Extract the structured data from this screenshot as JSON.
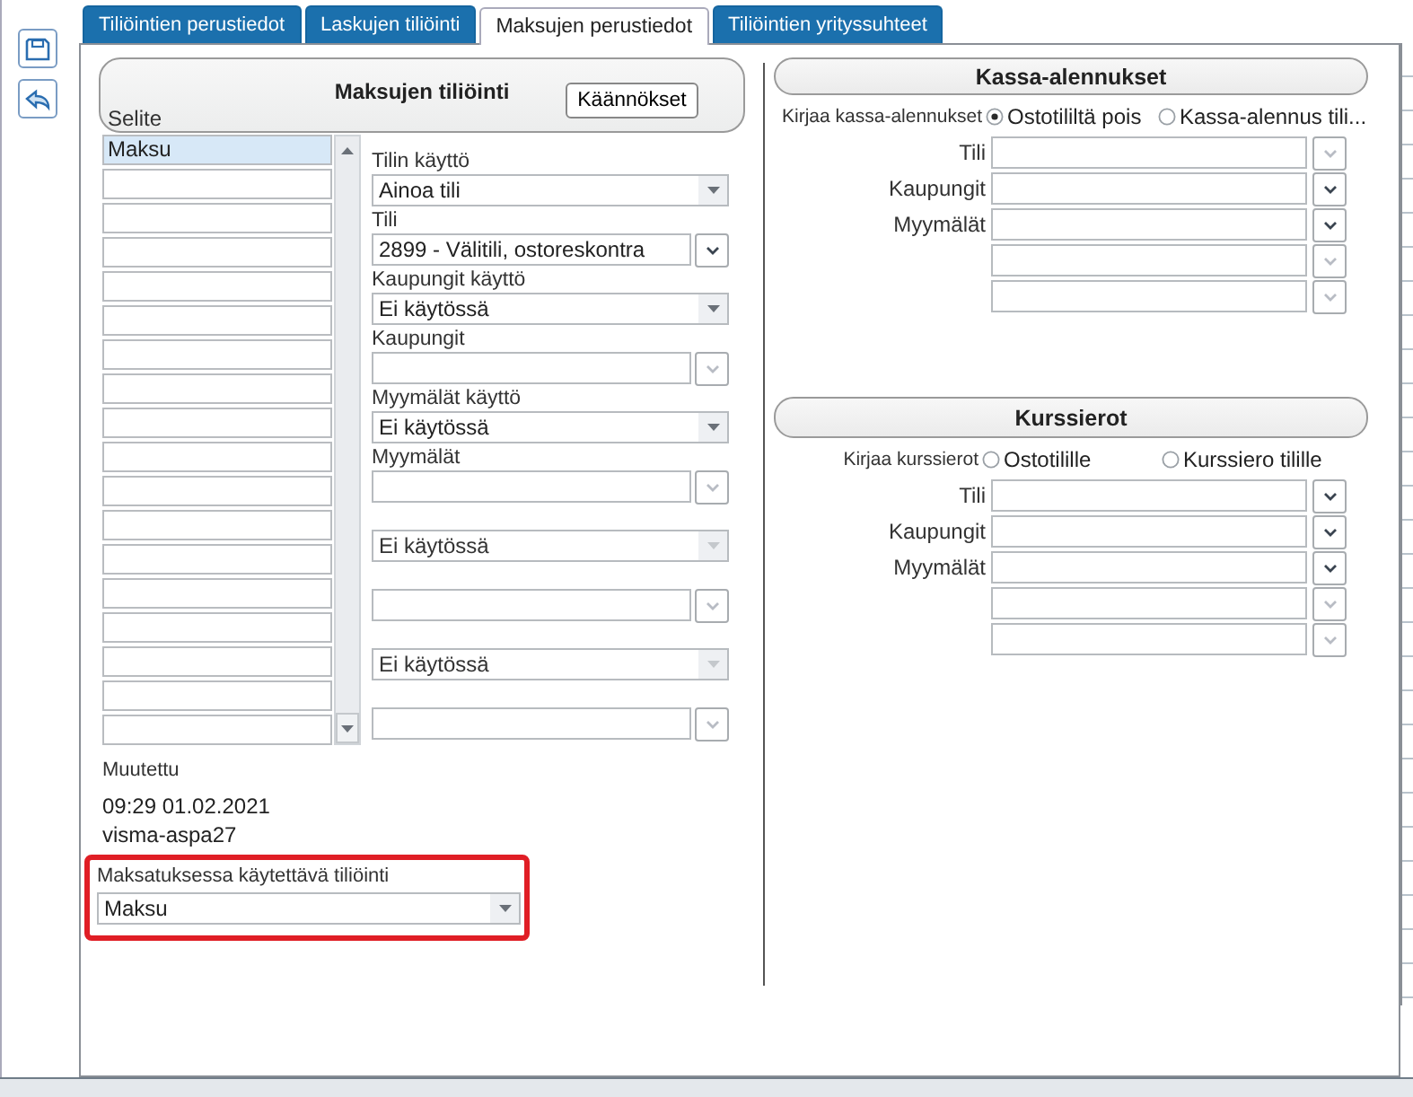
{
  "toolbar": [
    {
      "kind": "save"
    },
    {
      "kind": "undo"
    }
  ],
  "tabs": [
    {
      "label": "Tiliöintien perustiedot",
      "selected": false
    },
    {
      "label": "Laskujen tiliöinti",
      "selected": false
    },
    {
      "label": "Maksujen perustiedot",
      "selected": true
    },
    {
      "label": "Tiliöintien yrityssuhteet",
      "selected": false
    }
  ],
  "payment_posting": {
    "title": "Maksujen tiliöinti",
    "translations_button": "Käännökset",
    "description_label": "Selite",
    "descriptions": [
      {
        "value": "Maksu",
        "selected": true
      },
      {
        "selected": false
      },
      {
        "selected": false
      },
      {
        "selected": false
      },
      {
        "selected": false
      },
      {
        "selected": false
      },
      {
        "selected": false
      },
      {
        "selected": false
      },
      {
        "selected": false
      },
      {
        "selected": false
      },
      {
        "selected": false
      },
      {
        "selected": false
      },
      {
        "selected": false
      },
      {
        "selected": false
      },
      {
        "selected": false
      },
      {
        "selected": false
      },
      {
        "selected": false
      },
      {
        "selected": false
      }
    ],
    "fields": [
      {
        "label": "Tilin käyttö",
        "kind": "select",
        "value": "Ainoa tili",
        "disabled": false
      },
      {
        "label": "Tili",
        "kind": "lookup",
        "value": "2899 - Välitili, ostoreskontra",
        "disabled": false
      },
      {
        "label": "Kaupungit käyttö",
        "kind": "select",
        "value": "Ei käytössä",
        "disabled": false
      },
      {
        "label": "Kaupungit",
        "kind": "lookup",
        "disabled": true
      },
      {
        "label": "Myymälät käyttö",
        "kind": "select",
        "value": "Ei käytössä",
        "disabled": false
      },
      {
        "label": "Myymälät",
        "kind": "lookup",
        "disabled": true
      },
      {
        "kind": "select",
        "value": "Ei käytössä",
        "disabled": true
      },
      {
        "kind": "lookup",
        "disabled": true
      },
      {
        "kind": "select",
        "value": "Ei käytössä",
        "disabled": true
      },
      {
        "kind": "lookup",
        "disabled": true
      }
    ]
  },
  "modified": {
    "label": "Muutettu",
    "time": "09:29 01.02.2021",
    "user": "visma-aspa27"
  },
  "payment_account": {
    "label": "Maksatuksessa käytettävä tiliöinti",
    "value": "Maksu"
  },
  "cash_discounts": {
    "title": "Kassa-alennukset",
    "choice_label": "Kirjaa kassa-alennukset",
    "options": [
      {
        "label": "Ostotililtä pois",
        "selected": true
      },
      {
        "label": "Kassa-alennus tili...",
        "selected": false
      }
    ],
    "rows": [
      {
        "label": "Tili",
        "disabled": true
      },
      {
        "label": "Kaupungit",
        "disabled": false
      },
      {
        "label": "Myymälät",
        "disabled": false
      },
      {
        "disabled": true
      },
      {
        "disabled": true
      }
    ]
  },
  "exchange_differences": {
    "title": "Kurssierot",
    "choice_label": "Kirjaa kurssierot",
    "options": [
      {
        "label": "Ostotilille",
        "selected": false
      },
      {
        "label": "Kurssiero tilille",
        "selected": false
      }
    ],
    "rows": [
      {
        "label": "Tili",
        "disabled": false
      },
      {
        "label": "Kaupungit",
        "disabled": false
      },
      {
        "label": "Myymälät",
        "disabled": false
      },
      {
        "disabled": true
      },
      {
        "disabled": true
      }
    ]
  }
}
